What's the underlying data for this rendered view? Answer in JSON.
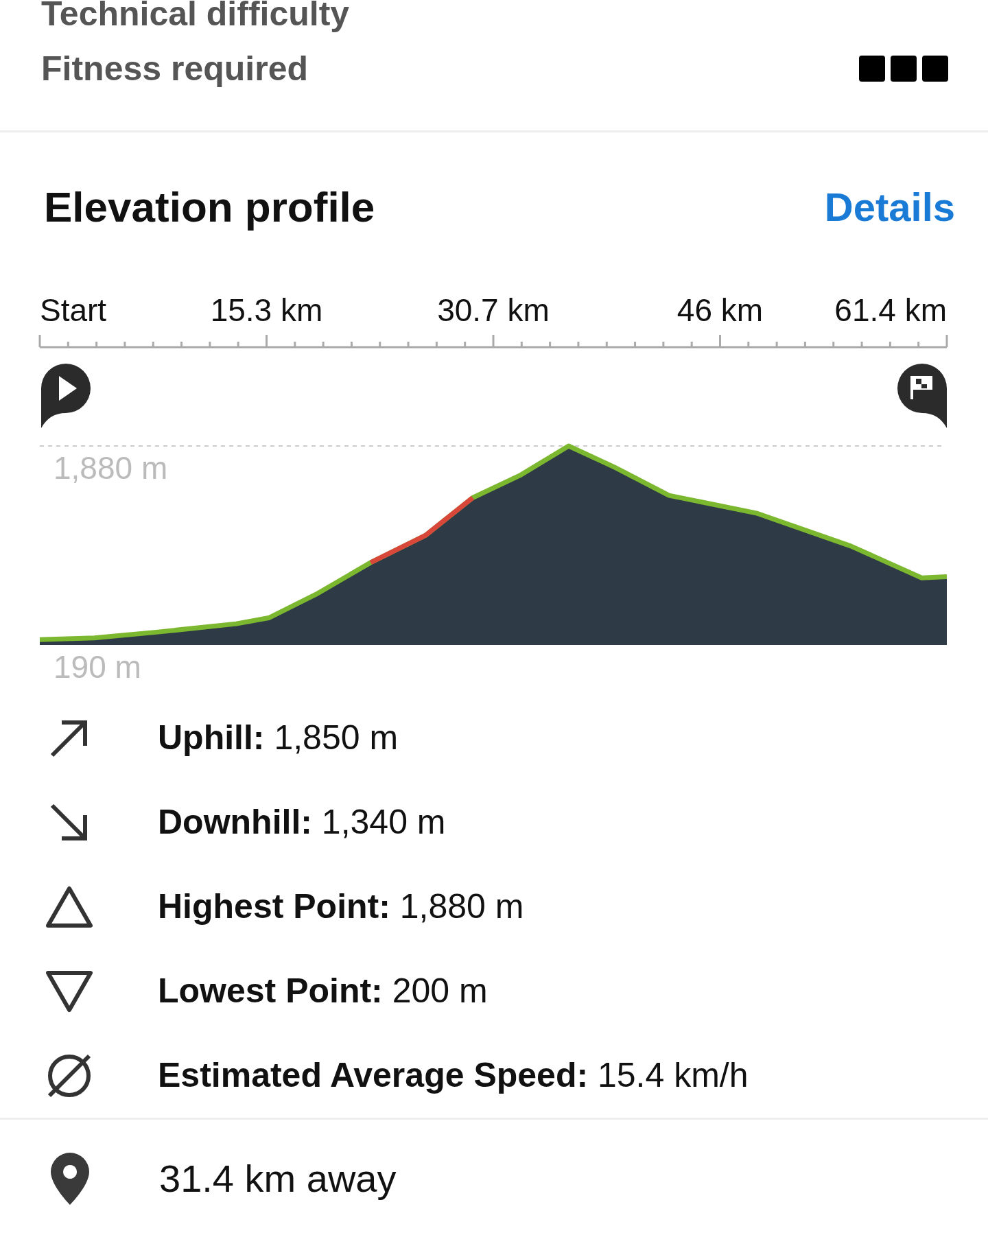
{
  "ratings": [
    {
      "label": "Technical difficulty"
    },
    {
      "label": "Fitness required",
      "stars": 3
    }
  ],
  "elevation_profile": {
    "title": "Elevation profile",
    "details_link": "Details",
    "distance_labels": [
      "Start",
      "15.3 km",
      "30.7 km",
      "46 km",
      "61.4 km"
    ],
    "max_elevation": "1,880 m",
    "min_elevation": "190 m",
    "stats": [
      {
        "kind": "uphill",
        "text": "**Uphill:** 1,850 m"
      },
      {
        "kind": "downhill",
        "text": "**Downhill:** 1,340 m"
      },
      {
        "kind": "highest",
        "text": "**Highest Point:** 1,880 m"
      },
      {
        "kind": "lowest",
        "text": "**Lowest Point:** 200 m"
      },
      {
        "kind": "speed",
        "text": "**Estimated Average Speed:** 15.4 km/h"
      }
    ]
  },
  "distance": {
    "text": "31.4 km away"
  }
}
